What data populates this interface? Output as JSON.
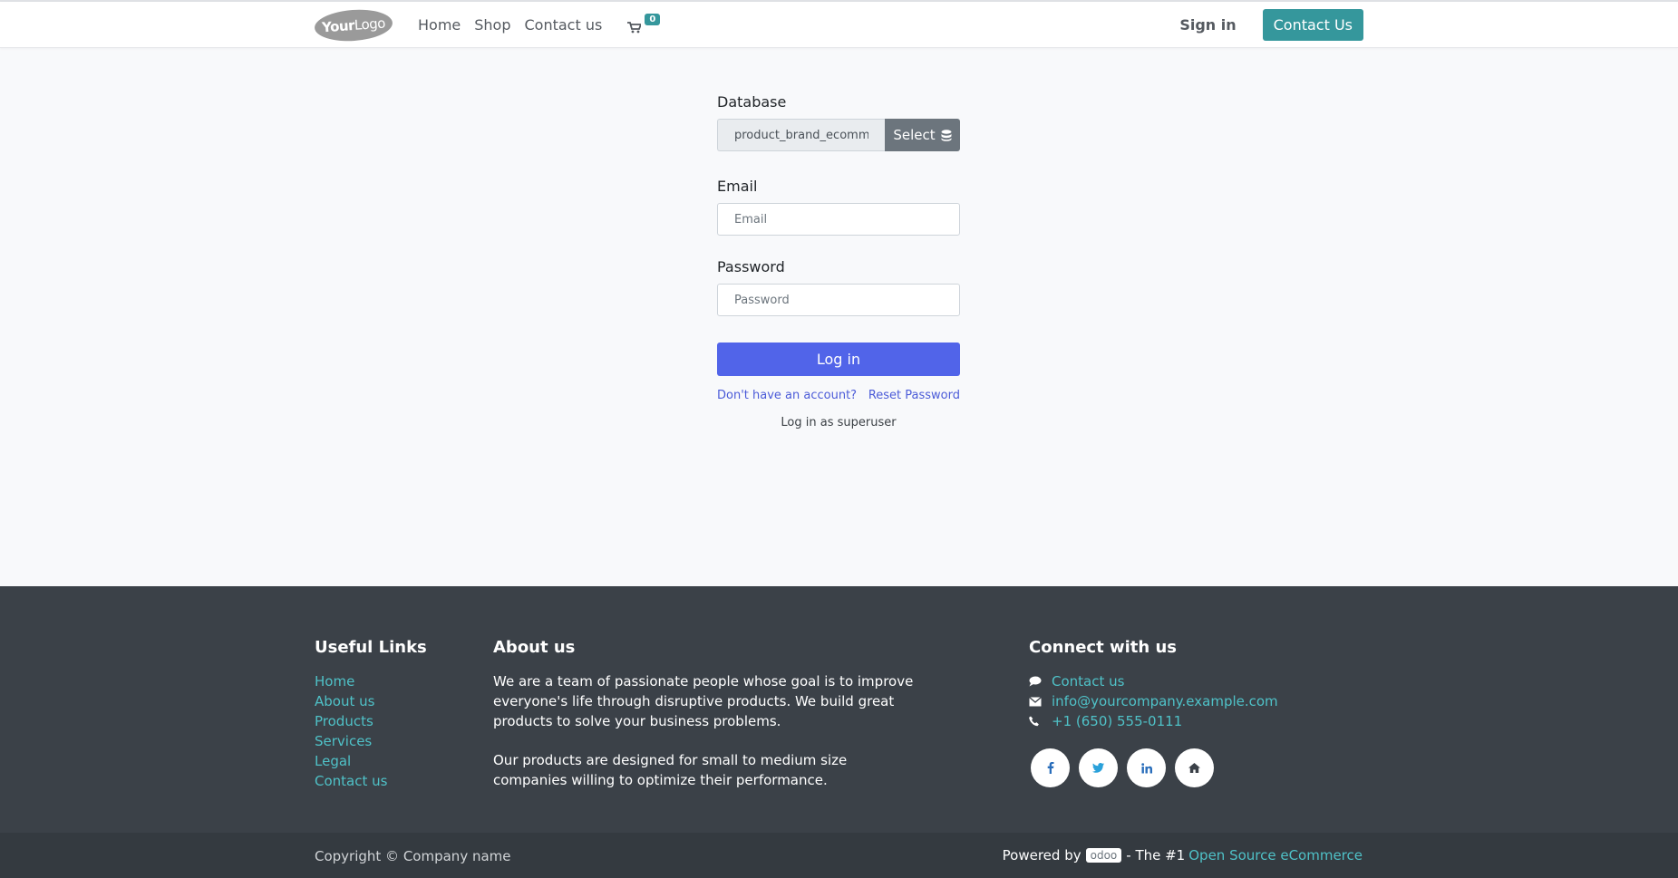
{
  "navbar": {
    "logo_prefix": "Your",
    "logo_suffix": "Logo",
    "links": [
      "Home",
      "Shop",
      "Contact us"
    ],
    "cart_count": "0",
    "signin_label": "Sign in",
    "contact_button": "Contact Us"
  },
  "login": {
    "database_label": "Database",
    "database_value": "product_brand_ecommerce",
    "select_label": "Select",
    "email_label": "Email",
    "email_placeholder": "Email",
    "password_label": "Password",
    "password_placeholder": "Password",
    "login_button": "Log in",
    "signup_link": "Don't have an account?",
    "reset_link": "Reset Password",
    "superuser_link": "Log in as superuser"
  },
  "footer": {
    "useful_title": "Useful Links",
    "useful_links": [
      "Home",
      "About us",
      "Products",
      "Services",
      "Legal",
      "Contact us"
    ],
    "about_title": "About us",
    "about_p1": "We are a team of passionate people whose goal is to improve everyone's life through disruptive products. We build great products to solve your business problems.",
    "about_p2": "Our products are designed for small to medium size companies willing to optimize their performance.",
    "connect_title": "Connect with us",
    "contact_us": "Contact us",
    "email": "info@yourcompany.example.com",
    "phone": "+1 (650) 555-0111",
    "socials": [
      "facebook-icon",
      "twitter-icon",
      "linkedin-icon",
      "home-icon"
    ]
  },
  "copyright": {
    "left": "Copyright © Company name",
    "powered_by": "Powered by",
    "odoo": "odoo",
    "tagline": "- The #1",
    "link": "Open Source eCommerce"
  },
  "colors": {
    "accent": "#35979c",
    "primary": "#5164e9",
    "footer_bg": "#3b4148",
    "link_teal": "#4fc1c7"
  }
}
